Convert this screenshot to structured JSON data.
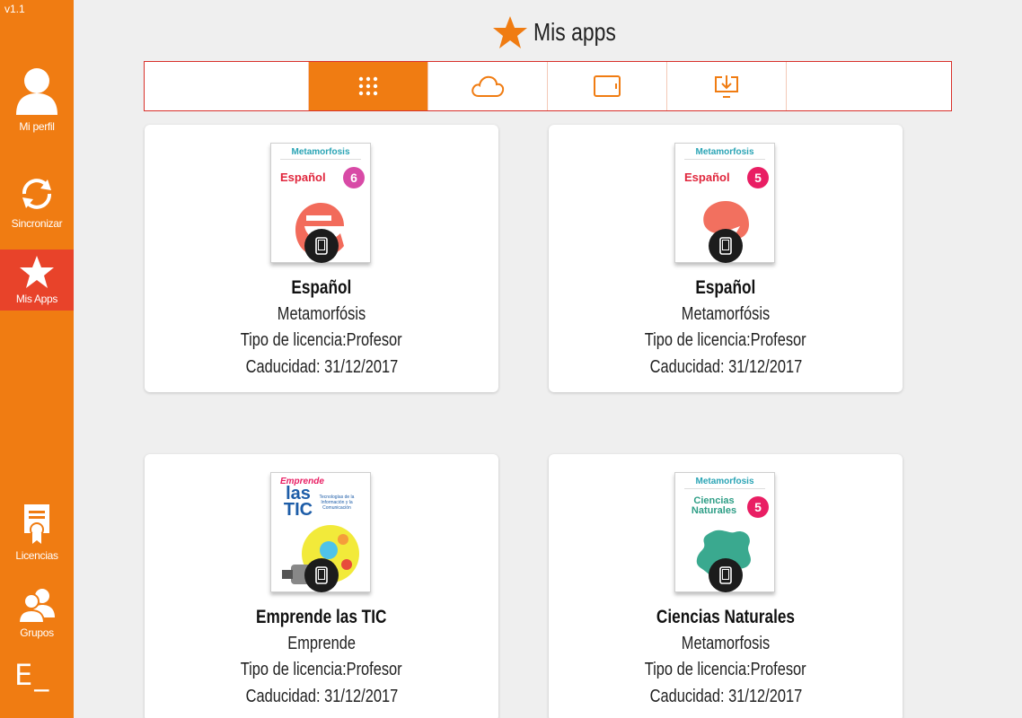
{
  "app": {
    "version": "v1.1"
  },
  "sidebar": {
    "items": [
      {
        "label": "Mi perfil",
        "icon": "user-icon"
      },
      {
        "label": "Sincronizar",
        "icon": "sync-icon"
      },
      {
        "label": "Mis Apps",
        "icon": "star-icon",
        "active": true
      },
      {
        "label": "Licencias",
        "icon": "license-icon"
      },
      {
        "label": "Grupos",
        "icon": "groups-icon"
      }
    ],
    "logo": "E_"
  },
  "header": {
    "title": "Mis apps",
    "icon": "star-icon"
  },
  "tabs": [
    {
      "name": "blank",
      "icon": ""
    },
    {
      "name": "all-apps",
      "icon": "grid-icon",
      "active": true
    },
    {
      "name": "cloud",
      "icon": "cloud-icon"
    },
    {
      "name": "tablet",
      "icon": "tablet-icon"
    },
    {
      "name": "download",
      "icon": "download-icon"
    },
    {
      "name": "blank",
      "icon": ""
    }
  ],
  "apps": [
    {
      "title": "Español",
      "publisher": "Metamorfósis",
      "license": "Tipo de licencia:Profesor",
      "expiry": "Caducidad: 31/12/2017",
      "cover": {
        "brand": "Metamorfosis",
        "subject": "Español",
        "grade": "6",
        "accent": "#d84aa6",
        "subject_color": "#e0263c"
      }
    },
    {
      "title": "Español",
      "publisher": "Metamorfósis",
      "license": "Tipo de licencia:Profesor",
      "expiry": "Caducidad: 31/12/2017",
      "cover": {
        "brand": "Metamorfosis",
        "subject": "Español",
        "grade": "5",
        "accent": "#e91e63",
        "subject_color": "#e0263c"
      }
    },
    {
      "title": "Emprende las TIC",
      "publisher": "Emprende",
      "license": "Tipo de licencia:Profesor",
      "expiry": "Caducidad: 31/12/2017",
      "cover": {
        "brand": "Emprende",
        "subject": "las TIC",
        "grade": "",
        "accent": "#e91e63",
        "subject_color": "#1d5da8",
        "tagline": "Tecnologías de la Información y la Comunicación"
      }
    },
    {
      "title": "Ciencias Naturales",
      "publisher": "Metamorfosis",
      "license": "Tipo de licencia:Profesor",
      "expiry": "Caducidad: 31/12/2017",
      "cover": {
        "brand": "Metamorfosis",
        "subject": "Ciencias Naturales",
        "grade": "5",
        "accent": "#e91e63",
        "subject_color": "#2e9e86"
      }
    }
  ],
  "colors": {
    "sidebar": "#f07c12",
    "active": "#e8432a",
    "tab_active": "#f07c12",
    "tab_border": "#d9302a",
    "background": "#efefef"
  }
}
